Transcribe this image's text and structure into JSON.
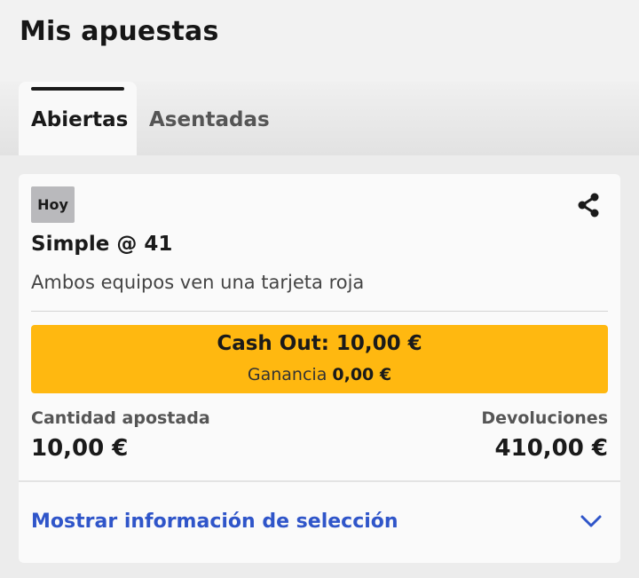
{
  "header": {
    "title": "Mis apuestas"
  },
  "tabs": [
    {
      "label": "Abiertas",
      "active": true
    },
    {
      "label": "Asentadas",
      "active": false
    }
  ],
  "bet": {
    "badge": "Hoy",
    "type": "Simple @ 41",
    "selection": "Ambos equipos ven una tarjeta roja",
    "cashout": {
      "title": "Cash Out: 10,00 €",
      "profit_label": "Ganancia",
      "profit_value": "0,00 €"
    },
    "stake_label": "Cantidad apostada",
    "stake_value": "10,00 €",
    "returns_label": "Devoluciones",
    "returns_value": "410,00 €",
    "show_info_label": "Mostrar información de selección"
  },
  "icons": {
    "share": "share-icon",
    "expand": "chevron-down-icon"
  },
  "colors": {
    "cashout": "#ffb810",
    "link": "#2f55c9",
    "badge": "#b9b9bc"
  }
}
